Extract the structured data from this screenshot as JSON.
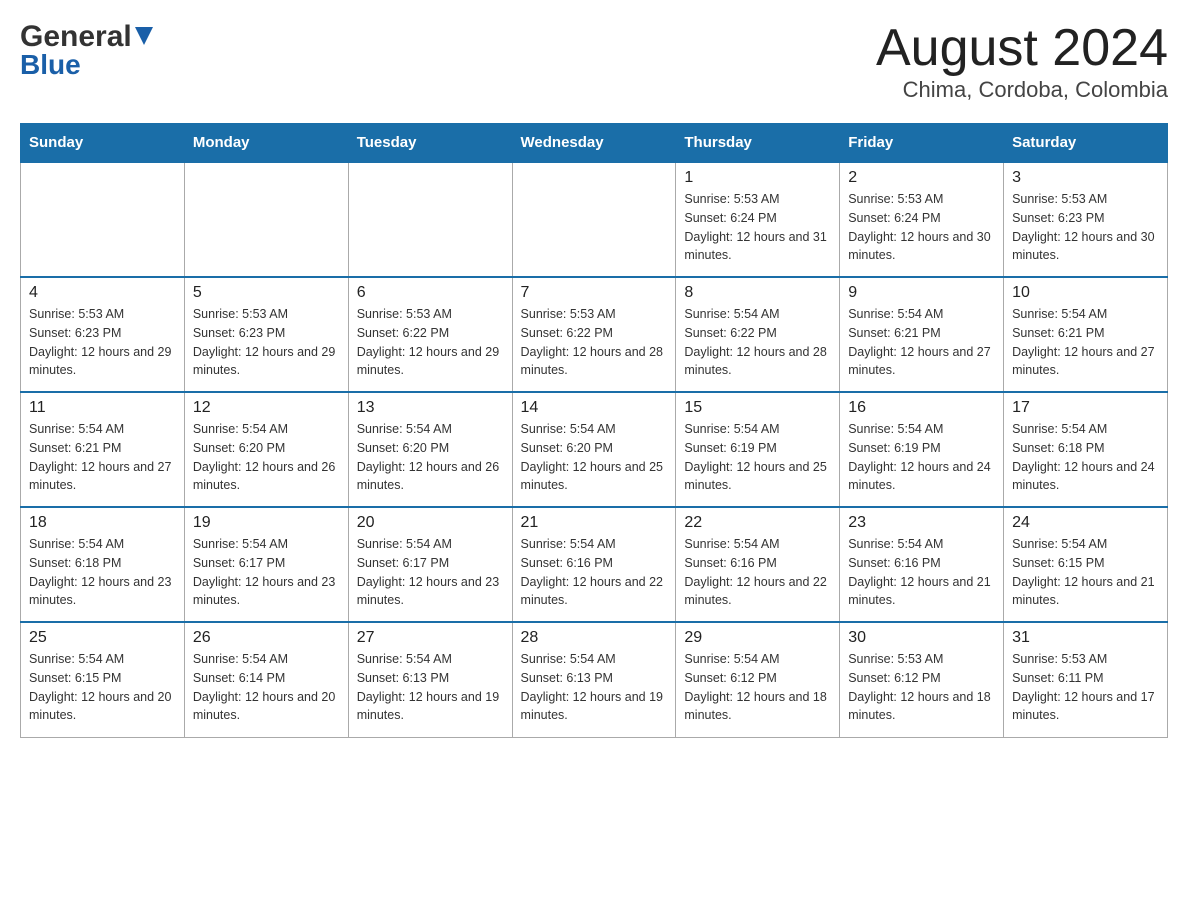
{
  "header": {
    "logo_general": "General",
    "logo_blue": "Blue",
    "title": "August 2024",
    "subtitle": "Chima, Cordoba, Colombia"
  },
  "days_of_week": [
    "Sunday",
    "Monday",
    "Tuesday",
    "Wednesday",
    "Thursday",
    "Friday",
    "Saturday"
  ],
  "weeks": [
    [
      {
        "day": "",
        "info": ""
      },
      {
        "day": "",
        "info": ""
      },
      {
        "day": "",
        "info": ""
      },
      {
        "day": "",
        "info": ""
      },
      {
        "day": "1",
        "info": "Sunrise: 5:53 AM\nSunset: 6:24 PM\nDaylight: 12 hours and 31 minutes."
      },
      {
        "day": "2",
        "info": "Sunrise: 5:53 AM\nSunset: 6:24 PM\nDaylight: 12 hours and 30 minutes."
      },
      {
        "day": "3",
        "info": "Sunrise: 5:53 AM\nSunset: 6:23 PM\nDaylight: 12 hours and 30 minutes."
      }
    ],
    [
      {
        "day": "4",
        "info": "Sunrise: 5:53 AM\nSunset: 6:23 PM\nDaylight: 12 hours and 29 minutes."
      },
      {
        "day": "5",
        "info": "Sunrise: 5:53 AM\nSunset: 6:23 PM\nDaylight: 12 hours and 29 minutes."
      },
      {
        "day": "6",
        "info": "Sunrise: 5:53 AM\nSunset: 6:22 PM\nDaylight: 12 hours and 29 minutes."
      },
      {
        "day": "7",
        "info": "Sunrise: 5:53 AM\nSunset: 6:22 PM\nDaylight: 12 hours and 28 minutes."
      },
      {
        "day": "8",
        "info": "Sunrise: 5:54 AM\nSunset: 6:22 PM\nDaylight: 12 hours and 28 minutes."
      },
      {
        "day": "9",
        "info": "Sunrise: 5:54 AM\nSunset: 6:21 PM\nDaylight: 12 hours and 27 minutes."
      },
      {
        "day": "10",
        "info": "Sunrise: 5:54 AM\nSunset: 6:21 PM\nDaylight: 12 hours and 27 minutes."
      }
    ],
    [
      {
        "day": "11",
        "info": "Sunrise: 5:54 AM\nSunset: 6:21 PM\nDaylight: 12 hours and 27 minutes."
      },
      {
        "day": "12",
        "info": "Sunrise: 5:54 AM\nSunset: 6:20 PM\nDaylight: 12 hours and 26 minutes."
      },
      {
        "day": "13",
        "info": "Sunrise: 5:54 AM\nSunset: 6:20 PM\nDaylight: 12 hours and 26 minutes."
      },
      {
        "day": "14",
        "info": "Sunrise: 5:54 AM\nSunset: 6:20 PM\nDaylight: 12 hours and 25 minutes."
      },
      {
        "day": "15",
        "info": "Sunrise: 5:54 AM\nSunset: 6:19 PM\nDaylight: 12 hours and 25 minutes."
      },
      {
        "day": "16",
        "info": "Sunrise: 5:54 AM\nSunset: 6:19 PM\nDaylight: 12 hours and 24 minutes."
      },
      {
        "day": "17",
        "info": "Sunrise: 5:54 AM\nSunset: 6:18 PM\nDaylight: 12 hours and 24 minutes."
      }
    ],
    [
      {
        "day": "18",
        "info": "Sunrise: 5:54 AM\nSunset: 6:18 PM\nDaylight: 12 hours and 23 minutes."
      },
      {
        "day": "19",
        "info": "Sunrise: 5:54 AM\nSunset: 6:17 PM\nDaylight: 12 hours and 23 minutes."
      },
      {
        "day": "20",
        "info": "Sunrise: 5:54 AM\nSunset: 6:17 PM\nDaylight: 12 hours and 23 minutes."
      },
      {
        "day": "21",
        "info": "Sunrise: 5:54 AM\nSunset: 6:16 PM\nDaylight: 12 hours and 22 minutes."
      },
      {
        "day": "22",
        "info": "Sunrise: 5:54 AM\nSunset: 6:16 PM\nDaylight: 12 hours and 22 minutes."
      },
      {
        "day": "23",
        "info": "Sunrise: 5:54 AM\nSunset: 6:16 PM\nDaylight: 12 hours and 21 minutes."
      },
      {
        "day": "24",
        "info": "Sunrise: 5:54 AM\nSunset: 6:15 PM\nDaylight: 12 hours and 21 minutes."
      }
    ],
    [
      {
        "day": "25",
        "info": "Sunrise: 5:54 AM\nSunset: 6:15 PM\nDaylight: 12 hours and 20 minutes."
      },
      {
        "day": "26",
        "info": "Sunrise: 5:54 AM\nSunset: 6:14 PM\nDaylight: 12 hours and 20 minutes."
      },
      {
        "day": "27",
        "info": "Sunrise: 5:54 AM\nSunset: 6:13 PM\nDaylight: 12 hours and 19 minutes."
      },
      {
        "day": "28",
        "info": "Sunrise: 5:54 AM\nSunset: 6:13 PM\nDaylight: 12 hours and 19 minutes."
      },
      {
        "day": "29",
        "info": "Sunrise: 5:54 AM\nSunset: 6:12 PM\nDaylight: 12 hours and 18 minutes."
      },
      {
        "day": "30",
        "info": "Sunrise: 5:53 AM\nSunset: 6:12 PM\nDaylight: 12 hours and 18 minutes."
      },
      {
        "day": "31",
        "info": "Sunrise: 5:53 AM\nSunset: 6:11 PM\nDaylight: 12 hours and 17 minutes."
      }
    ]
  ]
}
